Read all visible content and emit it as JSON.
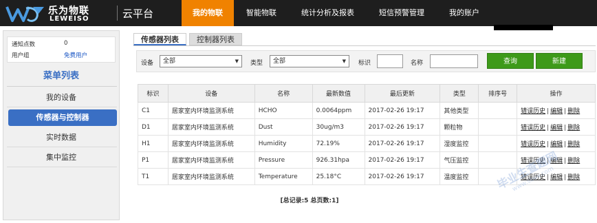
{
  "app": {
    "logo_cn": "乐为物联",
    "logo_en": "LEWEISO",
    "platform": "云平台"
  },
  "nav": {
    "items": [
      "我的物联",
      "智能物联",
      "统计分析及报表",
      "短信预警管理",
      "我的账户"
    ],
    "active_index": 0
  },
  "sidebar": {
    "info": {
      "notify_label": "通知点数",
      "notify_value": "0",
      "group_label": "用户组",
      "group_value": "免费用户"
    },
    "menu_title": "菜单列表",
    "items": [
      "我的设备",
      "传感器与控制器",
      "实时数据",
      "集中监控"
    ],
    "active_index": 1
  },
  "tabs": {
    "items": [
      "传感器列表",
      "控制器列表"
    ],
    "active_index": 0
  },
  "filters": {
    "device_label": "设备",
    "device_value": "全部",
    "type_label": "类型",
    "type_value": "全部",
    "tag_label": "标识",
    "tag_value": "",
    "name_label": "名称",
    "name_value": "",
    "query_button": "查询",
    "new_button": "新建"
  },
  "table": {
    "headers": [
      "标识",
      "设备",
      "名称",
      "最新数值",
      "最后更新",
      "类型",
      "排序号",
      "操作"
    ],
    "rows": [
      {
        "tag": "C1",
        "device": "居家室内环境监测系统",
        "name": "HCHO",
        "value": "0.0064ppm",
        "updated": "2017-02-26 19:17",
        "type": "其他类型",
        "order": ""
      },
      {
        "tag": "D1",
        "device": "居家室内环境监测系统",
        "name": "Dust",
        "value": "30ug/m3",
        "updated": "2017-02-26 19:17",
        "type": "颗粒物",
        "order": ""
      },
      {
        "tag": "H1",
        "device": "居家室内环境监测系统",
        "name": "Humidity",
        "value": "72.19%",
        "updated": "2017-02-26 19:17",
        "type": "湿度监控",
        "order": ""
      },
      {
        "tag": "P1",
        "device": "居家室内环境监测系统",
        "name": "Pressure",
        "value": "926.31hpa",
        "updated": "2017-02-26 19:17",
        "type": "气压监控",
        "order": ""
      },
      {
        "tag": "T1",
        "device": "居家室内环境监测系统",
        "name": "Temperature",
        "value": "25.18°C",
        "updated": "2017-02-26 19:17",
        "type": "温度监控",
        "order": ""
      }
    ],
    "ops": {
      "history": "错误历史",
      "edit": "编辑",
      "delete": "删除",
      "separator": "|"
    }
  },
  "footer": {
    "summary": "[总记录:5 总页数:1]"
  },
  "watermark": {
    "line1": "毕业生查题网",
    "line2": "www.sbvv.com"
  },
  "colors": {
    "topbar": "#1e1e1e",
    "nav_active": "#f08200",
    "accent_blue": "#3a6fc4",
    "button_green": "#3e9a1a"
  }
}
